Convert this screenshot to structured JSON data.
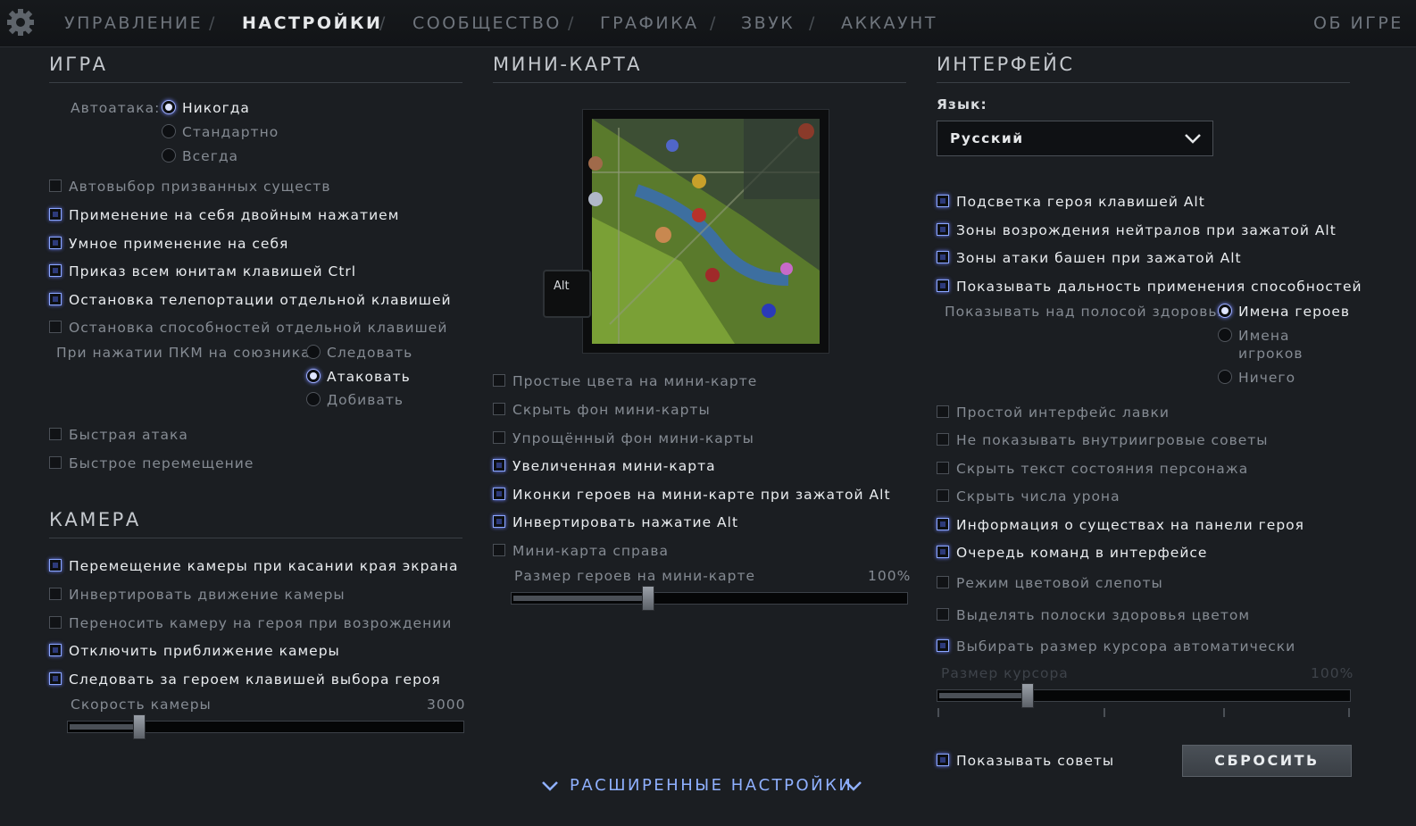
{
  "nav": {
    "items": [
      "УПРАВЛЕНИЕ",
      "НАСТРОЙКИ",
      "СООБЩЕСТВО",
      "ГРАФИКА",
      "ЗВУК",
      "АККАУНТ"
    ],
    "separator": "/",
    "about": "ОБ ИГРЕ",
    "active": "НАСТРОЙКИ"
  },
  "game": {
    "title": "ИГРА",
    "autoattack_label": "Автоатака:",
    "autoattack_options": [
      "Никогда",
      "Стандартно",
      "Всегда"
    ],
    "autoattack_selected": "Никогда",
    "options": [
      {
        "label": "Автовыбор призванных существ",
        "checked": false
      },
      {
        "label": "Применение на себя двойным нажатием",
        "checked": true
      },
      {
        "label": "Умное применение на себя",
        "checked": true
      },
      {
        "label": "Приказ всем юнитам клавишей Ctrl",
        "checked": true
      },
      {
        "label": "Остановка телепортации отдельной клавишей",
        "checked": true
      },
      {
        "label": "Остановка способностей отдельной клавишей",
        "checked": false
      }
    ],
    "rmb_label": "При нажатии ПКМ на союзника",
    "rmb_options": [
      "Следовать",
      "Атаковать",
      "Добивать"
    ],
    "rmb_selected": "Атаковать",
    "quick": [
      {
        "label": "Быстрая атака",
        "checked": false
      },
      {
        "label": "Быстрое перемещение",
        "checked": false
      }
    ]
  },
  "camera": {
    "title": "КАМЕРА",
    "options": [
      {
        "label": "Перемещение камеры при касании края экрана",
        "checked": true
      },
      {
        "label": "Инвертировать движение камеры",
        "checked": false
      },
      {
        "label": "Переносить камеру на героя при возрождении",
        "checked": false
      },
      {
        "label": "Отключить приближение камеры",
        "checked": true
      },
      {
        "label": "Следовать за героем клавишей выбора героя",
        "checked": true
      }
    ],
    "speed_label": "Скорость камеры",
    "speed_value": "3000",
    "speed_fraction": 0.17
  },
  "minimap": {
    "title": "МИНИ-КАРТА",
    "alt_key": "Alt",
    "options": [
      {
        "label": "Простые цвета на мини-карте",
        "checked": false
      },
      {
        "label": "Скрыть фон мини-карты",
        "checked": false
      },
      {
        "label": "Упрощённый фон мини-карты",
        "checked": false
      },
      {
        "label": "Увеличенная мини-карта",
        "checked": true
      },
      {
        "label": "Иконки героев на мини-карте при зажатой Alt",
        "checked": true
      },
      {
        "label": "Инвертировать нажатие Alt",
        "checked": true
      },
      {
        "label": "Мини-карта справа",
        "checked": false
      }
    ],
    "hero_size_label": "Размер героев на мини-карте",
    "hero_size_value": "100%",
    "hero_size_fraction": 0.34
  },
  "interface": {
    "title": "ИНТЕРФЕЙС",
    "language_label": "Язык:",
    "language_value": "Русский",
    "options_top": [
      {
        "label": "Подсветка героя клавишей Alt",
        "checked": true
      },
      {
        "label": "Зоны возрождения нейтралов при зажатой Alt",
        "checked": true
      },
      {
        "label": "Зоны атаки башен при зажатой Alt",
        "checked": true
      },
      {
        "label": "Показывать дальность применения способностей",
        "checked": true
      }
    ],
    "healthbar_label": "Показывать над полосой здоровья:",
    "healthbar_options": [
      "Имена героев",
      "Имена игроков",
      "Ничего"
    ],
    "healthbar_selected": "Имена героев",
    "options_bottom": [
      {
        "label": "Простой интерфейс лавки",
        "checked": false
      },
      {
        "label": "Не показывать внутриигровые советы",
        "checked": false
      },
      {
        "label": "Скрыть текст состояния персонажа",
        "checked": false
      },
      {
        "label": "Скрыть числа урона",
        "checked": false
      },
      {
        "label": "Информация о существах на панели героя",
        "checked": true
      },
      {
        "label": "Очередь команд в интерфейсе",
        "checked": true
      },
      {
        "label": "Режим цветовой слепоты",
        "checked": false
      },
      {
        "label": "Выделять полоски здоровья цветом",
        "checked": false
      },
      {
        "label": "Выбирать размер курсора автоматически",
        "checked": true
      }
    ],
    "cursor_label": "Размер курсора",
    "cursor_value": "100%",
    "cursor_fraction": 0.21,
    "show_tips_label": "Показывать советы",
    "show_tips_checked": true,
    "reset_label": "СБРОСИТЬ"
  },
  "advanced_label": "РАСШИРЕННЫЕ НАСТРОЙКИ",
  "colors": {
    "accent": "#8aa6ff",
    "background": "#1b1e22",
    "text_on": "#e9ecef",
    "text_off": "#858b93"
  }
}
